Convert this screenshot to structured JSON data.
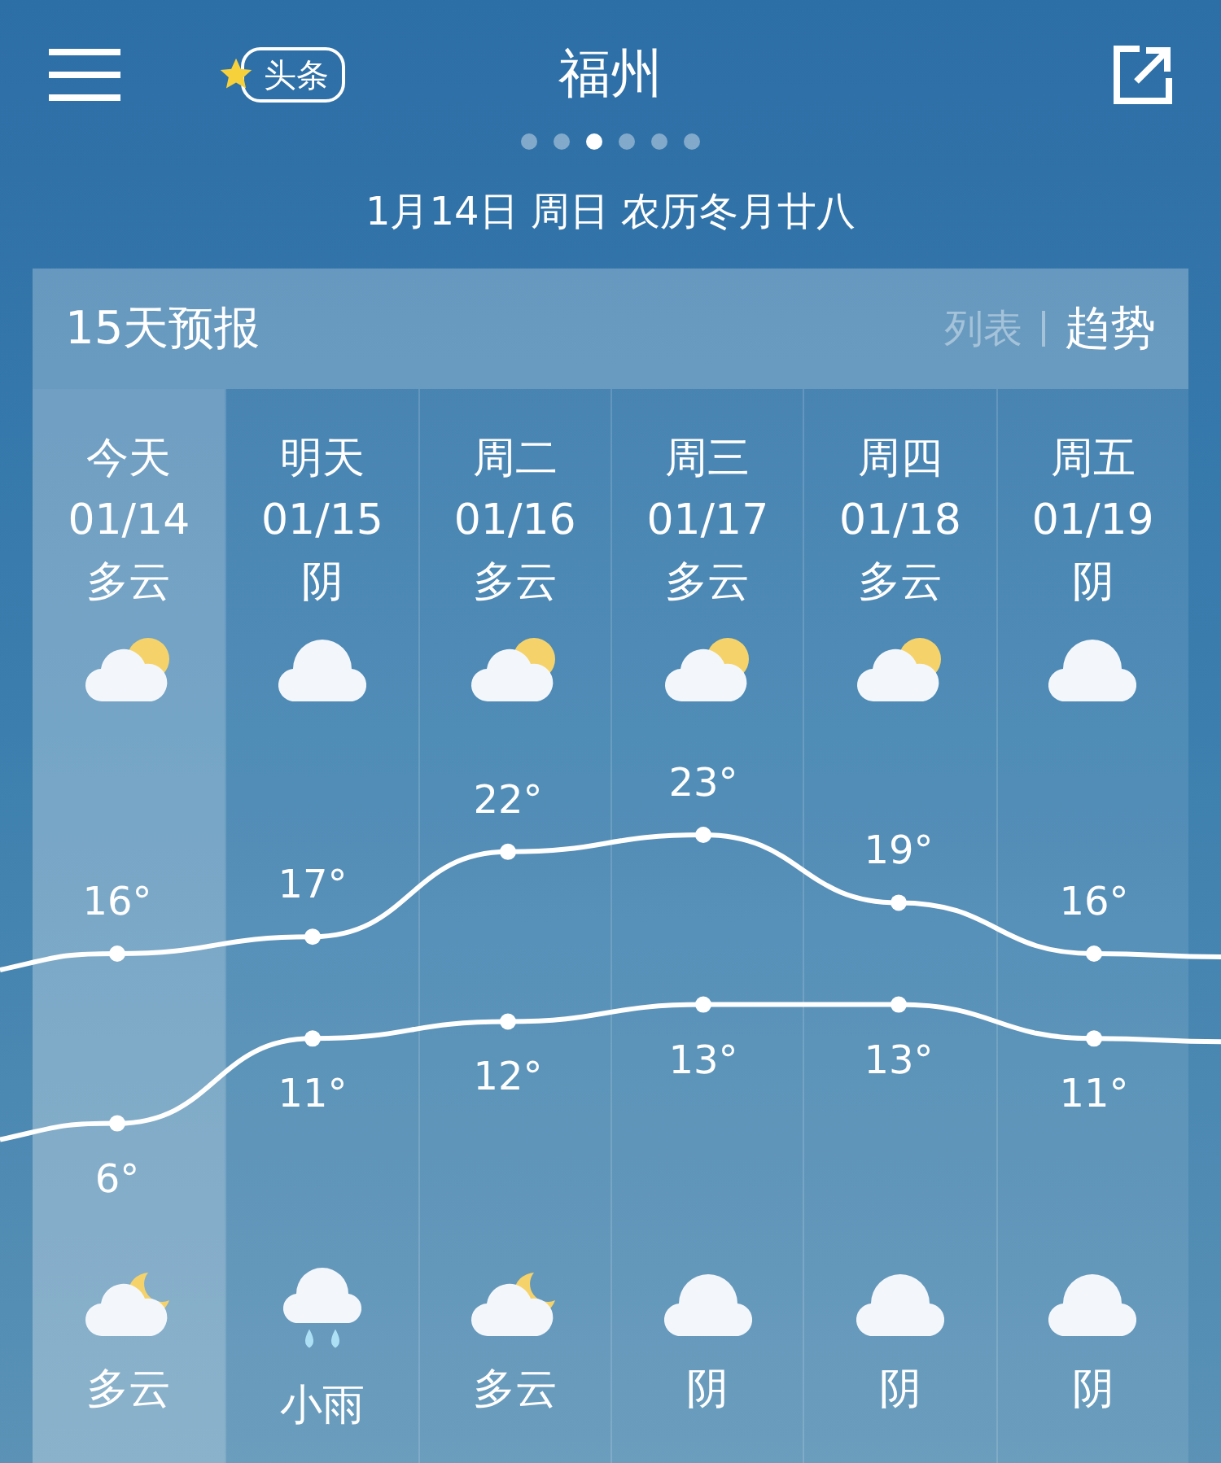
{
  "header": {
    "badge": "头条",
    "title": "福州",
    "page_dots": [
      {
        "selected": false
      },
      {
        "selected": false
      },
      {
        "selected": true
      },
      {
        "selected": false
      },
      {
        "selected": false
      },
      {
        "selected": false
      }
    ]
  },
  "date_line": "1月14日  周日  农历冬月廿八",
  "forecast": {
    "title": "15天预报",
    "views": [
      {
        "label": "列表",
        "selected": false
      },
      {
        "label": "趋势",
        "selected": true
      }
    ],
    "days": [
      {
        "day": "今天",
        "date": "01/14",
        "day_condition": "多云",
        "day_icon": {
          "kind": "partly_cloudy_day"
        },
        "night_icon": {
          "kind": "partly_cloudy_night"
        },
        "night_condition": "多云",
        "selected": true
      },
      {
        "day": "明天",
        "date": "01/15",
        "day_condition": "阴",
        "day_icon": {
          "kind": "cloudy"
        },
        "night_icon": {
          "kind": "rain"
        },
        "night_condition": "小雨",
        "selected": false
      },
      {
        "day": "周二",
        "date": "01/16",
        "day_condition": "多云",
        "day_icon": {
          "kind": "partly_cloudy_day"
        },
        "night_icon": {
          "kind": "partly_cloudy_night"
        },
        "night_condition": "多云",
        "selected": false
      },
      {
        "day": "周三",
        "date": "01/17",
        "day_condition": "多云",
        "day_icon": {
          "kind": "partly_cloudy_day"
        },
        "night_icon": {
          "kind": "cloudy"
        },
        "night_condition": "阴",
        "selected": false
      },
      {
        "day": "周四",
        "date": "01/18",
        "day_condition": "多云",
        "day_icon": {
          "kind": "partly_cloudy_day"
        },
        "night_icon": {
          "kind": "cloudy"
        },
        "night_condition": "阴",
        "selected": false
      },
      {
        "day": "周五",
        "date": "01/19",
        "day_condition": "阴",
        "day_icon": {
          "kind": "cloudy"
        },
        "night_icon": {
          "kind": "cloudy"
        },
        "night_condition": "阴",
        "selected": false
      }
    ],
    "chart_data": {
      "type": "line",
      "series": [
        {
          "color": "#ffffff",
          "marker": "circle",
          "values": [
            16,
            17,
            22,
            23,
            19,
            16
          ],
          "value_labels": [
            "16°",
            "17°",
            "22°",
            "23°",
            "19°",
            "16°"
          ]
        },
        {
          "color": "#ffffff",
          "marker": "circle",
          "values": [
            6,
            11,
            12,
            13,
            13,
            11
          ],
          "value_labels": [
            "6°",
            "11°",
            "12°",
            "13°",
            "13°",
            "11°"
          ]
        }
      ]
    }
  }
}
